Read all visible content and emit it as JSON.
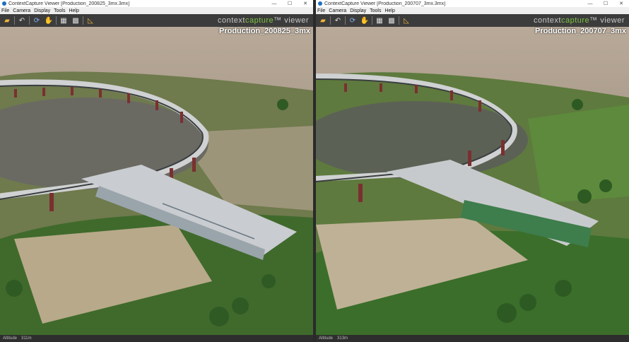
{
  "windows": [
    {
      "title": "ContextCapture Viewer [Production_200825_3mx.3mx]",
      "scene_label": "Production_200825_3mx",
      "altitude_label": "Altitude",
      "altitude_value": "311m"
    },
    {
      "title": "ContextCapture Viewer [Production_200707_3mx.3mx]",
      "scene_label": "Production_200707_3mx",
      "altitude_label": "Altitude",
      "altitude_value": "313m"
    }
  ],
  "menu": [
    "File",
    "Camera",
    "Display",
    "Tools",
    "Help"
  ],
  "brand": {
    "prefix": "context",
    "accent": "capture",
    "suffix": "™ viewer"
  },
  "window_buttons": {
    "minimize": "—",
    "maximize": "☐",
    "close": "✕"
  },
  "toolbar_icons": [
    "folder-open-icon",
    "undo-icon",
    "rotate-icon",
    "pan-hand-icon",
    "checkerboard-icon",
    "texture-icon",
    "measure-icon"
  ],
  "colors": {
    "accent_green": "#7cc242",
    "toolbar_bg": "#3c3c3c",
    "sky_top": "#b9aa99",
    "sky_bottom": "#8d8272"
  }
}
